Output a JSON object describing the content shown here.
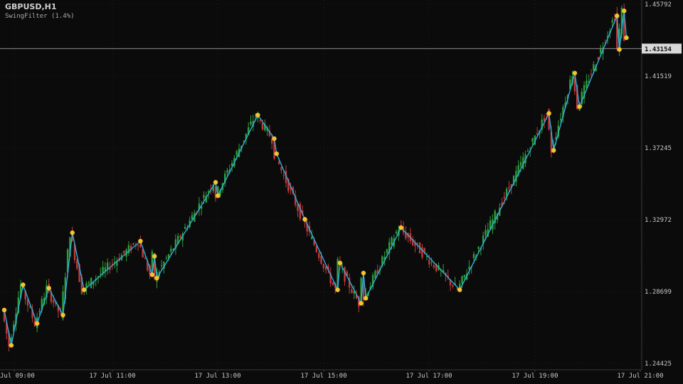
{
  "header": {
    "symbol": "GBPUSD,H1",
    "indicator": "SwingFilter (1.4%)"
  },
  "colors": {
    "background": "#0b0b0b",
    "bull": "#2e9e3c",
    "bear": "#c23a3a",
    "swing_line": "#2fb4e8",
    "swing_point": "#f5c32c",
    "axis_text": "#c8c8c8",
    "price_line": "#8a8a8a"
  },
  "chart_data": {
    "type": "candlestick",
    "title": "GBPUSD,H1",
    "indicator": "SwingFilter (1.4%)",
    "ylim": [
      1.23,
      1.46
    ],
    "x_ticks": [
      "Jul 09:00",
      "17 Jul 11:00",
      "17 Jul 13:00",
      "17 Jul 15:00",
      "17 Jul 17:00",
      "17 Jul 19:00",
      "17 Jul 21:00"
    ],
    "y_ticks": [
      "1.45792",
      "1.41519",
      "1.37245",
      "1.32972",
      "1.28699",
      "1.24425"
    ],
    "y_tick_values": [
      1.45792,
      1.41519,
      1.37245,
      1.32972,
      1.28699,
      1.24425
    ],
    "current_price": 1.43154,
    "current_price_label": "1.43154",
    "grid": true,
    "swing_points": [
      [
        0,
        1.276
      ],
      [
        3,
        1.255
      ],
      [
        8,
        1.291
      ],
      [
        14,
        1.268
      ],
      [
        19,
        1.289
      ],
      [
        25,
        1.273
      ],
      [
        29,
        1.322
      ],
      [
        34,
        1.288
      ],
      [
        58,
        1.317
      ],
      [
        63,
        1.297
      ],
      [
        64,
        1.308
      ],
      [
        65,
        1.295
      ],
      [
        90,
        1.352
      ],
      [
        91,
        1.344
      ],
      [
        108,
        1.392
      ],
      [
        115,
        1.378
      ],
      [
        116,
        1.369
      ],
      [
        128,
        1.33
      ],
      [
        142,
        1.288
      ],
      [
        143,
        1.304
      ],
      [
        152,
        1.28
      ],
      [
        153,
        1.298
      ],
      [
        154,
        1.283
      ],
      [
        169,
        1.325
      ],
      [
        194,
        1.288
      ],
      [
        232,
        1.393
      ],
      [
        234,
        1.371
      ],
      [
        243,
        1.417
      ],
      [
        245,
        1.397
      ],
      [
        261,
        1.451
      ],
      [
        262,
        1.431
      ],
      [
        264,
        1.454
      ],
      [
        265,
        1.438
      ]
    ]
  }
}
